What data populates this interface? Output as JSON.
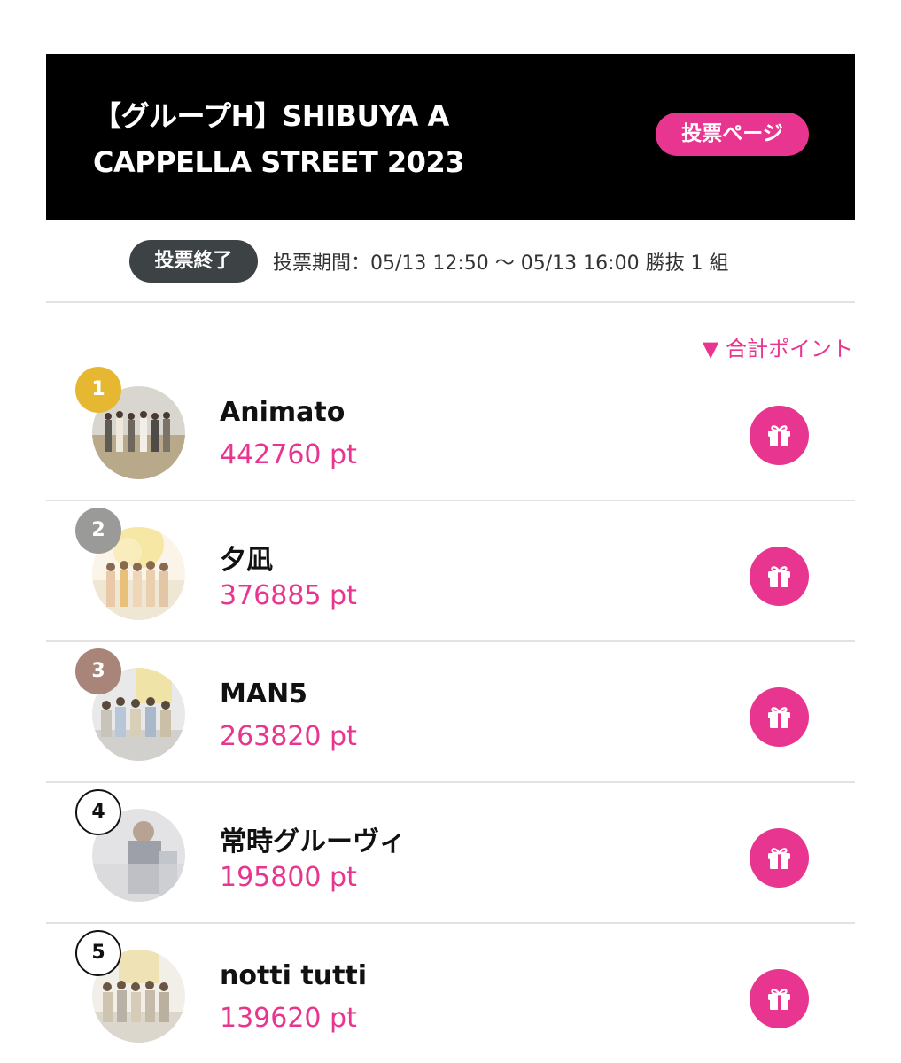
{
  "header": {
    "title": "【グループH】SHIBUYA A CAPPELLA STREET 2023",
    "vote_page_label": "投票ページ"
  },
  "status": {
    "badge": "投票終了",
    "period": "投票期間：05/13 12:50 〜 05/13 16:00 勝抜 1 組"
  },
  "sort": {
    "label": "▼ 合計ポイント"
  },
  "ranking": [
    {
      "rank": "1",
      "name": "Animato",
      "points": "442760 pt"
    },
    {
      "rank": "2",
      "name": "夕凪",
      "points": "376885 pt"
    },
    {
      "rank": "3",
      "name": "MAN5",
      "points": "263820 pt"
    },
    {
      "rank": "4",
      "name": "常時グルーヴィ",
      "points": "195800 pt"
    },
    {
      "rank": "5",
      "name": "notti tutti",
      "points": "139620 pt"
    }
  ],
  "colors": {
    "accent": "#e8358f",
    "rank_gold": "#e6b832",
    "rank_silver": "#9a9a98",
    "rank_bronze": "#a88578",
    "header_bg": "#000000",
    "badge_bg": "#3d4245"
  },
  "icons": {
    "gift": "gift-icon"
  }
}
